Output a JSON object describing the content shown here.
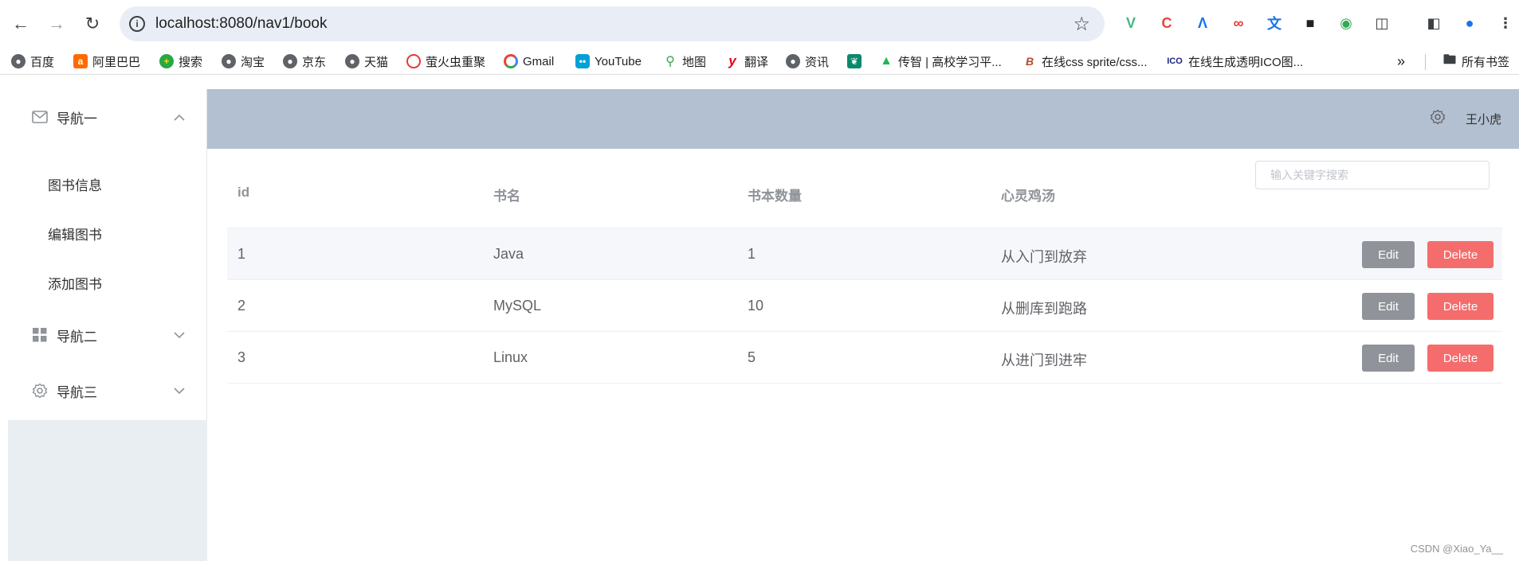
{
  "browser": {
    "url": "localhost:8080/nav1/book",
    "bookmarks": [
      {
        "label": "百度",
        "icon": "globe-icon",
        "color": "#5f6368"
      },
      {
        "label": "阿里巴巴",
        "icon": "alibaba-icon",
        "color": "#ff6a00"
      },
      {
        "label": "搜索",
        "icon": "search-icon",
        "color": "#27a844"
      },
      {
        "label": "淘宝",
        "icon": "globe-icon",
        "color": "#5f6368"
      },
      {
        "label": "京东",
        "icon": "globe-icon",
        "color": "#5f6368"
      },
      {
        "label": "天猫",
        "icon": "globe-icon",
        "color": "#5f6368"
      },
      {
        "label": "萤火虫重聚",
        "icon": "firefly-icon",
        "color": "#e53935"
      },
      {
        "label": "Gmail",
        "icon": "gmail-icon",
        "color": "#ea4335"
      },
      {
        "label": "YouTube",
        "icon": "bilibili-icon",
        "color": "#00a1d6"
      },
      {
        "label": "地图",
        "icon": "maps-icon",
        "color": "#34a853"
      },
      {
        "label": "翻译",
        "icon": "translate-icon",
        "color": "#e3001b"
      },
      {
        "label": "资讯",
        "icon": "globe-icon",
        "color": "#5f6368"
      },
      {
        "label": "",
        "icon": "leaf-icon",
        "color": "#0b8a6b"
      },
      {
        "label": "传智 | 高校学习平...",
        "icon": "graduation-icon",
        "color": "#1db954"
      },
      {
        "label": "在线css sprite/css...",
        "icon": "css-icon",
        "color": "#b5492a"
      },
      {
        "label": "在线生成透明ICO图...",
        "icon": "ico-icon",
        "color": "#1a237e"
      }
    ],
    "all_bookmarks": "所有书签"
  },
  "sidebar": {
    "nav1": {
      "label": "导航一",
      "icon": "mail-icon"
    },
    "nav1_items": [
      "图书信息",
      "编辑图书",
      "添加图书"
    ],
    "nav2": {
      "label": "导航二",
      "icon": "grid-icon"
    },
    "nav3": {
      "label": "导航三",
      "icon": "gear-icon"
    }
  },
  "header": {
    "username": "王小虎"
  },
  "table": {
    "columns": [
      "id",
      "书名",
      "书本数量",
      "心灵鸡汤"
    ],
    "search_placeholder": "输入关键字搜索",
    "rows": [
      {
        "id": "1",
        "name": "Java",
        "count": "1",
        "quote": "从入门到放弃"
      },
      {
        "id": "2",
        "name": "MySQL",
        "count": "10",
        "quote": "从删库到跑路"
      },
      {
        "id": "3",
        "name": "Linux",
        "count": "5",
        "quote": "从进门到进牢"
      }
    ],
    "edit_label": "Edit",
    "delete_label": "Delete"
  },
  "watermark": "CSDN @Xiao_Ya__"
}
